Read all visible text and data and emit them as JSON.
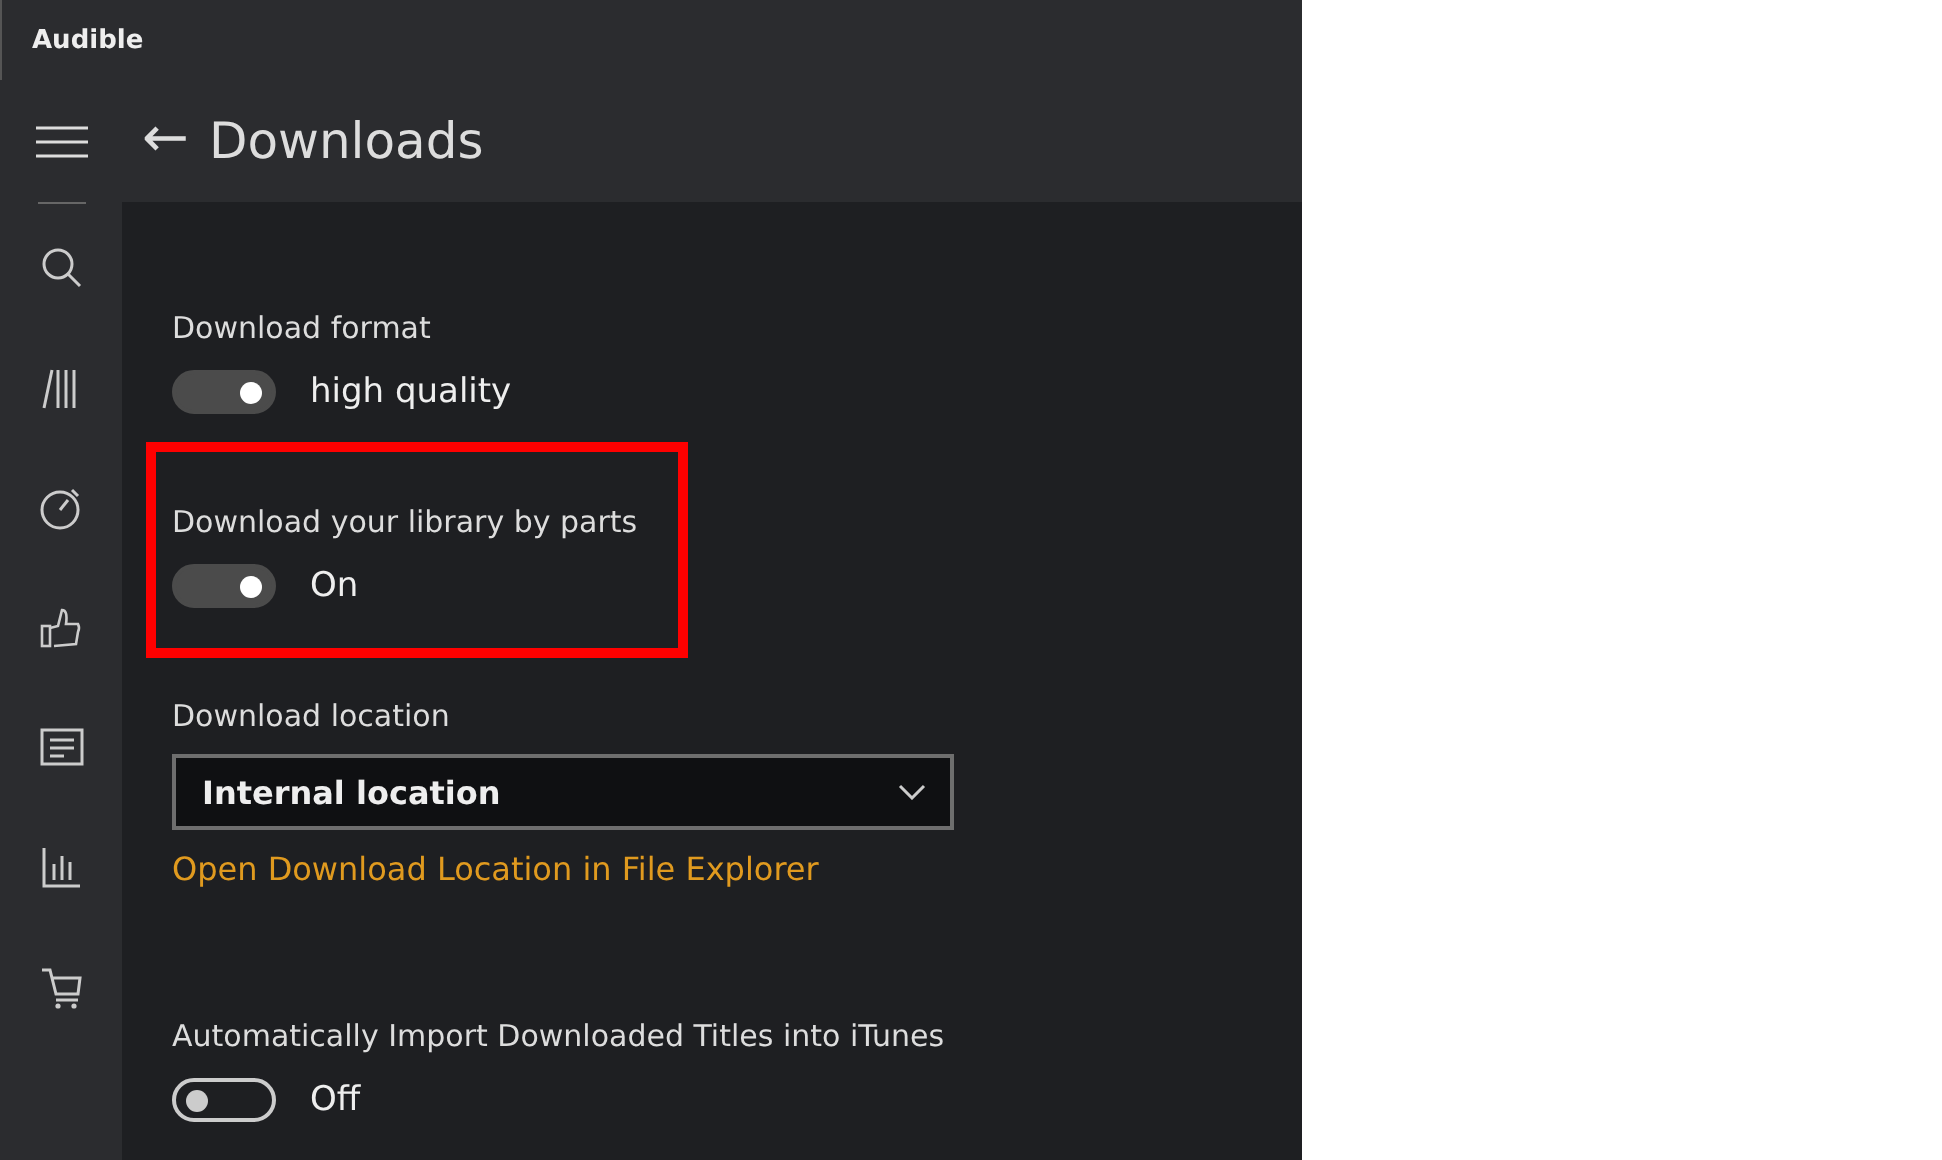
{
  "window": {
    "title": "Audible"
  },
  "header": {
    "back": "←",
    "title": "Downloads"
  },
  "sidebar": {
    "items": [
      {
        "kind": "search"
      },
      {
        "kind": "library"
      },
      {
        "kind": "timer"
      },
      {
        "kind": "thumb"
      },
      {
        "kind": "news"
      },
      {
        "kind": "stats"
      },
      {
        "kind": "cart"
      }
    ]
  },
  "settings": [
    {
      "kind": "toggle",
      "label": "Download format",
      "on": true,
      "state_text": "high quality",
      "highlighted": false
    },
    {
      "kind": "toggle",
      "label": "Download your library by parts",
      "on": true,
      "state_text": "On",
      "highlighted": true
    },
    {
      "kind": "dropdown",
      "label": "Download location",
      "value": "Internal location",
      "link": "Open Download Location in File Explorer",
      "highlighted": false
    },
    {
      "kind": "toggle",
      "label": "Automatically Import Downloaded Titles into iTunes",
      "on": false,
      "state_text": "Off",
      "highlighted": false
    }
  ]
}
